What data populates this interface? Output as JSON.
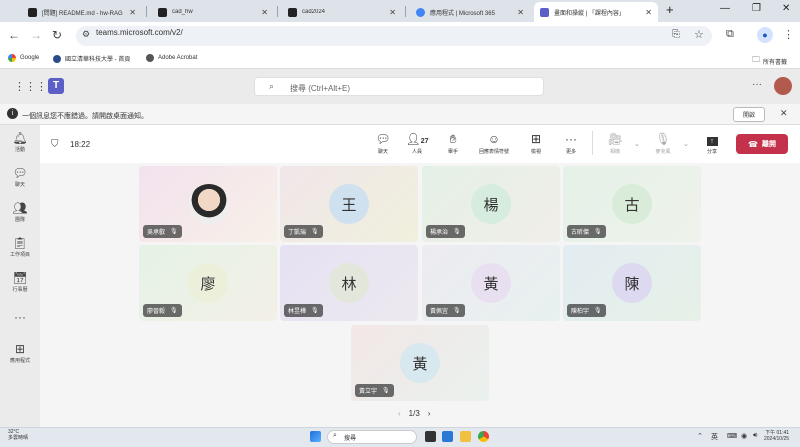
{
  "browser": {
    "tabs": [
      {
        "label": "[問題] README.md - hw-RAG",
        "favicon_color": "#222222",
        "active": false
      },
      {
        "label": "cad_hw",
        "favicon_color": "#222222",
        "active": false
      },
      {
        "label": "cad2024",
        "favicon_color": "#222222",
        "active": false
      },
      {
        "label": "應用程式 | Microsoft 365",
        "favicon_color": "#4285f4",
        "active": false
      },
      {
        "label": "畫面和操縱 | 「課程內容」",
        "favicon_color": "#5b5fc7",
        "active": true
      }
    ],
    "new_tab": "+",
    "url": "teams.microsoft.com/v2/",
    "bookmarks": [
      {
        "label": "Google",
        "icon": "google-icon"
      },
      {
        "label": "國立清華科技大學 - 首頁",
        "icon": "school-icon"
      },
      {
        "label": "Adobe Acrobat",
        "icon": "acrobat-icon"
      }
    ],
    "all_bookmarks": "所有書籤"
  },
  "teams": {
    "search_placeholder": "搜尋 (Ctrl+Alt+E)",
    "notice": "一個訊息您不應錯過。請開啟桌面通知。",
    "notice_button": "開啟",
    "rail": [
      {
        "label": "活動",
        "icon": "bell-icon"
      },
      {
        "label": "聊天",
        "icon": "chat-icon"
      },
      {
        "label": "團隊",
        "icon": "teams-icon"
      },
      {
        "label": "工作項目",
        "icon": "assignments-icon"
      },
      {
        "label": "行事曆",
        "icon": "calendar-icon"
      },
      {
        "label": "",
        "icon": "more-icon"
      },
      {
        "label": "應用程式",
        "icon": "apps-icon"
      }
    ]
  },
  "meeting": {
    "timer": "18:22",
    "participant_count": "27",
    "toolbar": [
      {
        "label": "聊天",
        "icon": "chat-icon",
        "disabled": false
      },
      {
        "label": "人員",
        "icon": "people-icon",
        "disabled": false
      },
      {
        "label": "舉手",
        "icon": "raise-hand-icon",
        "disabled": false
      },
      {
        "label": "回應表情符號",
        "icon": "emoji-icon",
        "disabled": false
      },
      {
        "label": "檢視",
        "icon": "view-icon",
        "disabled": false
      },
      {
        "label": "更多",
        "icon": "more-icon",
        "disabled": false
      },
      {
        "label": "相機",
        "icon": "camera-icon",
        "disabled": true
      },
      {
        "label": "麥克風",
        "icon": "mic-icon",
        "disabled": true
      },
      {
        "label": "分享",
        "icon": "share-icon",
        "disabled": false
      }
    ],
    "leave_label": "離開",
    "participants": [
      {
        "name": "吳承叡",
        "initial": "",
        "has_photo": true,
        "bg": "#f3e2ee",
        "avatar_bg": "#f2f2f2"
      },
      {
        "name": "丁凱瑞",
        "initial": "王",
        "has_photo": false,
        "bg": "#f1ecdf",
        "avatar_bg": "#cfe0ee"
      },
      {
        "name": "楊承治",
        "initial": "楊",
        "has_photo": false,
        "bg": "#e4f0e6",
        "avatar_bg": "#d5ecde"
      },
      {
        "name": "古昕傑",
        "initial": "古",
        "has_photo": false,
        "bg": "#e5f1e8",
        "avatar_bg": "#d8ecd9"
      },
      {
        "name": "廖晉毅",
        "initial": "廖",
        "has_photo": false,
        "bg": "#ebf3e3",
        "avatar_bg": "#ecefd9"
      },
      {
        "name": "林昱樺",
        "initial": "林",
        "has_photo": false,
        "bg": "#e6e3f2",
        "avatar_bg": "#e3e7db"
      },
      {
        "name": "黃佩宜",
        "initial": "黃",
        "has_photo": false,
        "bg": "#ecebf1",
        "avatar_bg": "#e8dff0"
      },
      {
        "name": "陳柏宇",
        "initial": "陳",
        "has_photo": false,
        "bg": "#e2ecf2",
        "avatar_bg": "#ddd9f0"
      },
      {
        "name": "黃立宇",
        "initial": "黃",
        "has_photo": false,
        "bg": "#f2e7e6",
        "avatar_bg": "#d7e8ee"
      }
    ],
    "page": "1/3"
  },
  "taskbar": {
    "weather_temp": "32°C",
    "weather_desc": "多雲時晴",
    "search_placeholder": "搜尋",
    "time": "下午 01:41",
    "date": "2024/10/25"
  }
}
